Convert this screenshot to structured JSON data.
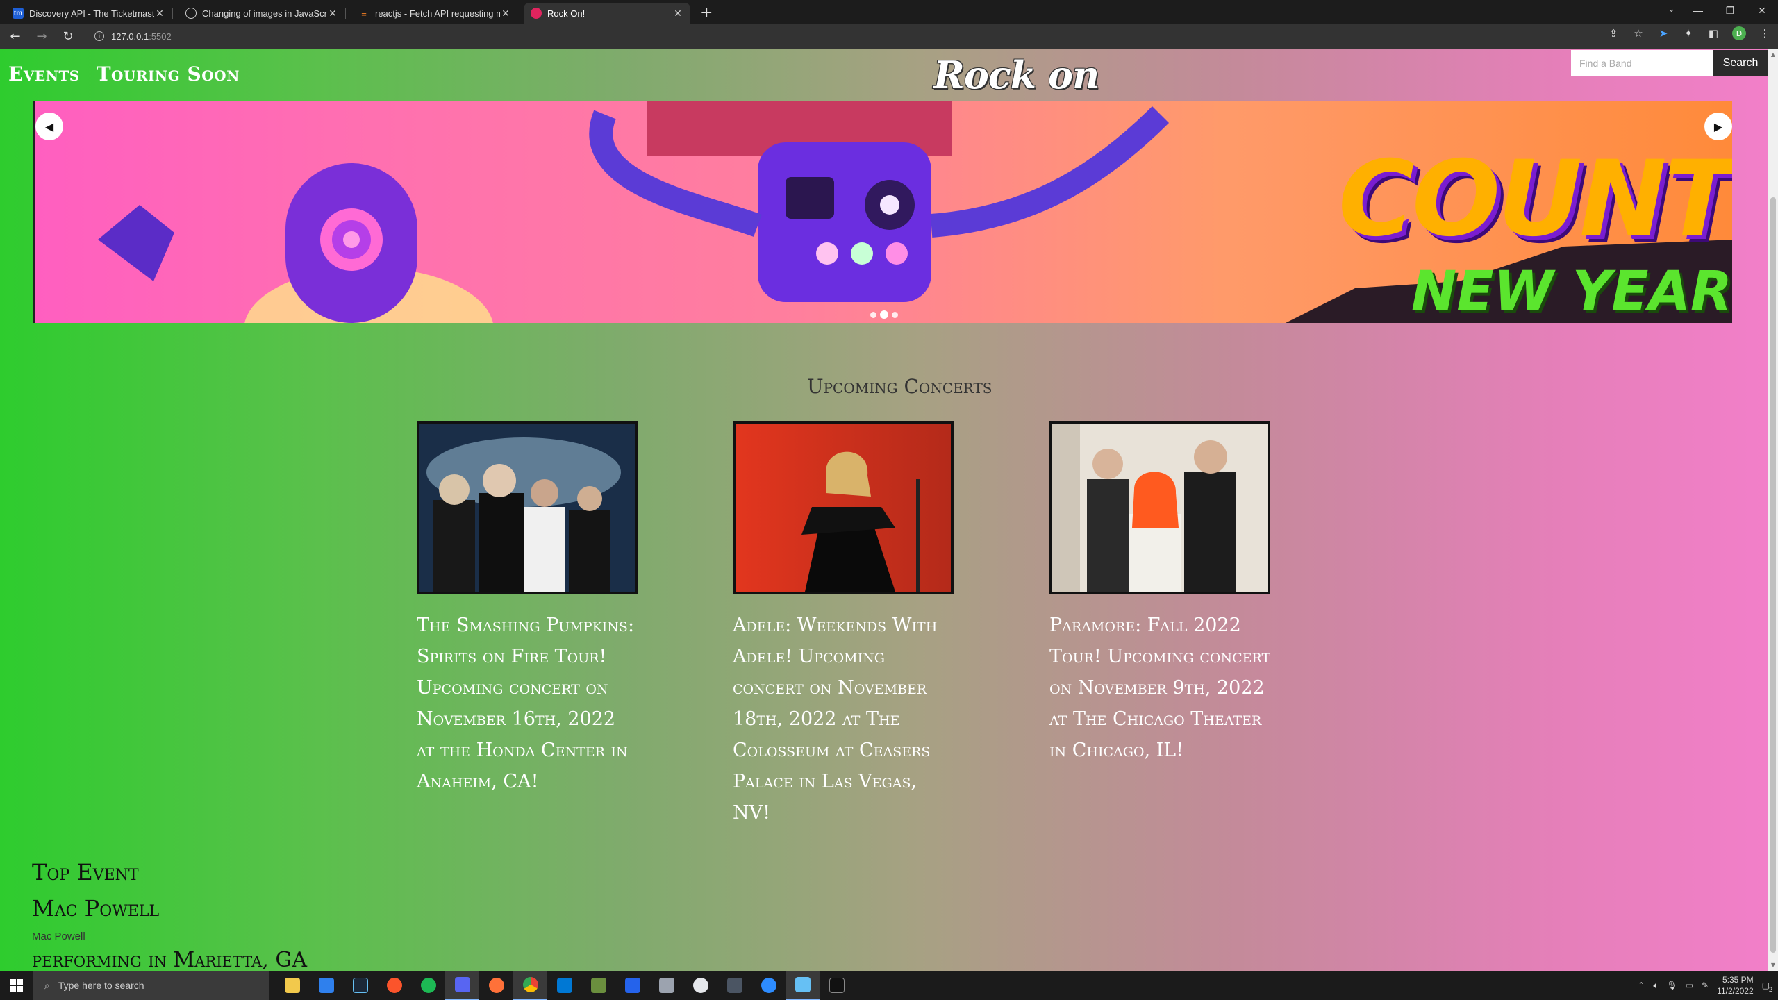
{
  "browser": {
    "tabs": [
      {
        "title": "Discovery API - The Ticketmaster",
        "icon": "tm-icon",
        "fav_text": "tm",
        "fav_color": "#1e5fd6"
      },
      {
        "title": "Changing of images in JavaScript",
        "icon": "globe-icon",
        "fav_text": "",
        "fav_color": "#555555"
      },
      {
        "title": "reactjs - Fetch API requesting m",
        "icon": "stackoverflow-icon",
        "fav_text": "",
        "fav_color": "#f48024"
      },
      {
        "title": "Rock On!",
        "icon": "rock-icon",
        "fav_text": "",
        "fav_color": "#e0245e"
      }
    ],
    "address": "127.0.0.1",
    "port": ":5502"
  },
  "page": {
    "nav": [
      "Events",
      "Touring Soon"
    ],
    "logo": "Rock on",
    "search": {
      "placeholder": "Find a Band",
      "button": "Search"
    },
    "carousel": {
      "headline": "COUNT",
      "subline": "NEW YEAR",
      "slides": 3,
      "active_slide": 1
    },
    "section_title": "Upcoming Concerts",
    "cards": [
      {
        "desc": "The Smashing Pumpkins: Spirits on Fire Tour! Upcoming concert on November 16th, 2022 at the Honda Center in Anaheim, CA!"
      },
      {
        "desc": "Adele: Weekends With Adele! Upcoming concert on November 18th, 2022 at The Colosseum at Ceasers Palace in Las Vegas, NV!"
      },
      {
        "desc": "Paramore: Fall 2022 Tour! Upcoming concert on November 9th, 2022 at The Chicago Theater in Chicago, IL!"
      }
    ],
    "top_event": {
      "heading": "Top Event",
      "name": "Mac Powell",
      "small": "Mac Powell",
      "performing": "performing in Marietta, GA"
    }
  },
  "taskbar": {
    "search_placeholder": "Type here to search",
    "time": "5:35 PM",
    "date": "11/2/2022",
    "notif_count": "2"
  }
}
